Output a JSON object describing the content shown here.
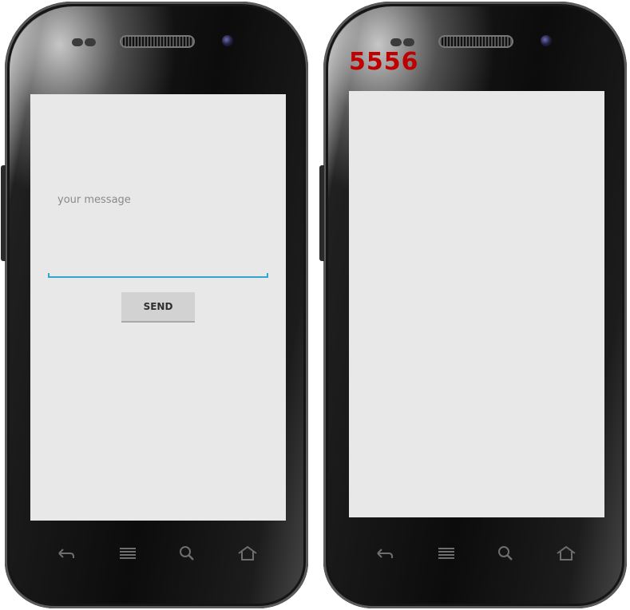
{
  "left_phone": {
    "screen": {
      "message_label": "your message",
      "message_input": {
        "value": "",
        "placeholder": ""
      },
      "send_button_label": "SEND"
    },
    "nav_icons": [
      "back-icon",
      "menu-icon",
      "search-icon",
      "home-icon"
    ]
  },
  "right_phone": {
    "emulator_label": "5556",
    "nav_icons": [
      "back-icon",
      "menu-icon",
      "search-icon",
      "home-icon"
    ]
  },
  "colors": {
    "screen_bg": "#e8e8e8",
    "input_underline": "#33a6cf",
    "emulator_label": "#c00000",
    "button_bg": "#d2d2d2"
  }
}
